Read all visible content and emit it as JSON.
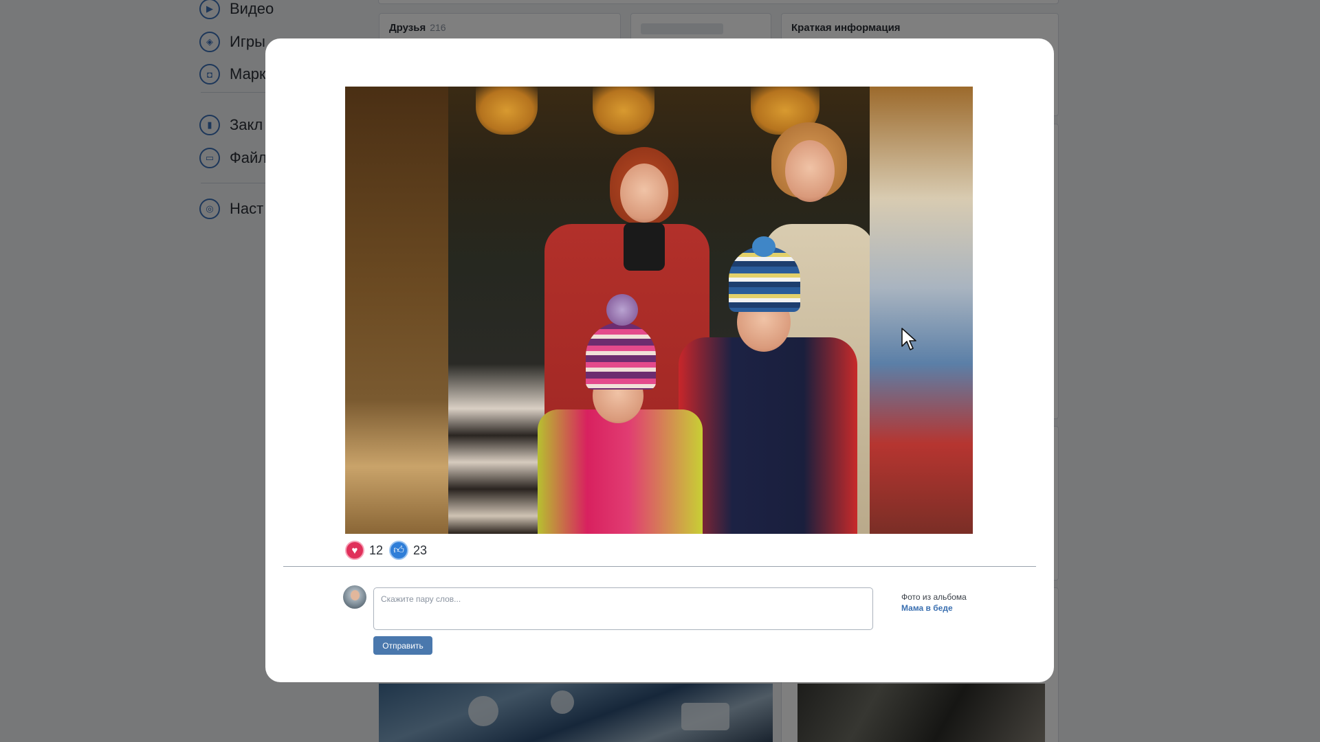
{
  "nav": {
    "items": [
      {
        "label": "Видео",
        "icon": "play-icon"
      },
      {
        "label": "Игры",
        "icon": "gamepad-icon"
      },
      {
        "label": "Марк",
        "icon": "bag-icon"
      },
      {
        "label": "Закл",
        "icon": "bookmark-icon"
      },
      {
        "label": "Файл",
        "icon": "folder-icon"
      },
      {
        "label": "Наст",
        "icon": "settings-icon"
      }
    ]
  },
  "friends_card": {
    "title": "Друзья",
    "count": "216"
  },
  "info_card": {
    "title": "Краткая информация"
  },
  "photo_viewer": {
    "reactions": {
      "heart": {
        "icon": "heart-icon",
        "count": "12"
      },
      "like": {
        "icon": "thumbs-up-icon",
        "count": "23"
      }
    },
    "comment": {
      "placeholder": "Скажите пару слов...",
      "value": "",
      "send_label": "Отправить"
    },
    "album": {
      "label": "Фото из альбома",
      "name": "Мама в беде"
    }
  },
  "colors": {
    "accent": "#4a78ad",
    "link": "#3a6fb0",
    "heart": "#e0305a",
    "like": "#2f7ed8",
    "overlay": "rgba(0,0,0,0.5)"
  }
}
